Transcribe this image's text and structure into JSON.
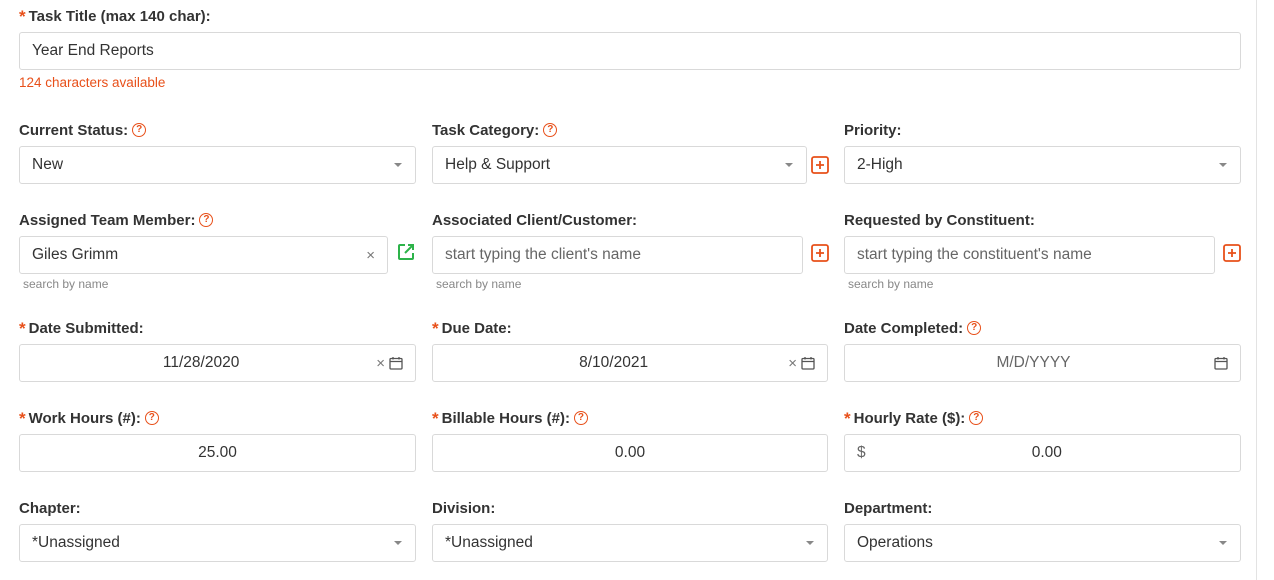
{
  "task_title": {
    "label": "Task Title (max 140 char):",
    "value": "Year End Reports",
    "chars_available": "124 characters available"
  },
  "current_status": {
    "label": "Current Status:",
    "value": "New"
  },
  "task_category": {
    "label": "Task Category:",
    "value": "Help & Support"
  },
  "priority": {
    "label": "Priority:",
    "value": "2-High"
  },
  "assigned_team_member": {
    "label": "Assigned Team Member:",
    "value": "Giles Grimm",
    "hint": "search by name"
  },
  "associated_client": {
    "label": "Associated Client/Customer:",
    "placeholder": "start typing the client's name",
    "hint": "search by name"
  },
  "requested_by": {
    "label": "Requested by Constituent:",
    "placeholder": "start typing the constituent's name",
    "hint": "search by name"
  },
  "date_submitted": {
    "label": "Date Submitted:",
    "value": "11/28/2020"
  },
  "due_date": {
    "label": "Due Date:",
    "value": "8/10/2021"
  },
  "date_completed": {
    "label": "Date Completed:",
    "placeholder": "M/D/YYYY"
  },
  "work_hours": {
    "label": "Work Hours (#):",
    "value": "25.00"
  },
  "billable_hours": {
    "label": "Billable Hours (#):",
    "value": "0.00"
  },
  "hourly_rate": {
    "label": "Hourly Rate ($):",
    "prefix": "$",
    "value": "0.00"
  },
  "chapter": {
    "label": "Chapter:",
    "value": "*Unassigned"
  },
  "division": {
    "label": "Division:",
    "value": "*Unassigned"
  },
  "department": {
    "label": "Department:",
    "value": "Operations"
  },
  "symbols": {
    "required": "*",
    "help": "?",
    "clear": "×"
  },
  "colors": {
    "accent": "#e8501a",
    "link_icon": "#2db34a",
    "border": "#d9d9d9"
  }
}
